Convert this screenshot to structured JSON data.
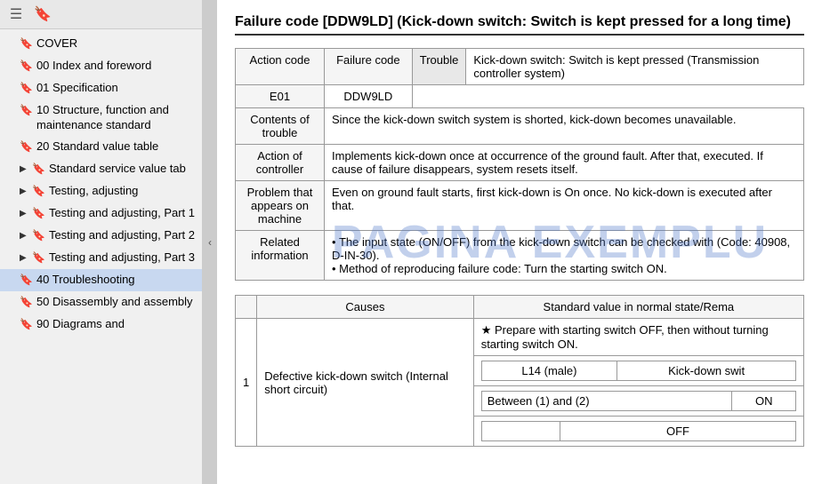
{
  "sidebar": {
    "toolbar": {
      "icon1": "☰",
      "icon2": "🔖"
    },
    "items": [
      {
        "id": "cover",
        "label": "COVER",
        "indent": 0,
        "expand": false,
        "hasExpand": false
      },
      {
        "id": "00-index",
        "label": "00 Index and foreword",
        "indent": 0,
        "expand": false,
        "hasExpand": false
      },
      {
        "id": "01-spec",
        "label": "01 Specification",
        "indent": 0,
        "expand": false,
        "hasExpand": false
      },
      {
        "id": "10-structure",
        "label": "10 Structure, function and maintenance standard",
        "indent": 0,
        "expand": false,
        "hasExpand": false
      },
      {
        "id": "20-standard",
        "label": "20 Standard value table",
        "indent": 0,
        "expand": false,
        "hasExpand": false
      },
      {
        "id": "std-service",
        "label": "Standard service value tab",
        "indent": 1,
        "expand": true,
        "hasExpand": true
      },
      {
        "id": "testing1",
        "label": "Testing, adjusting",
        "indent": 1,
        "expand": true,
        "hasExpand": true
      },
      {
        "id": "testing-adj-1",
        "label": "Testing and adjusting, Part 1",
        "indent": 1,
        "expand": false,
        "hasExpand": true
      },
      {
        "id": "testing-adj-2",
        "label": "Testing and adjusting, Part 2",
        "indent": 1,
        "expand": false,
        "hasExpand": true
      },
      {
        "id": "testing-adj-3",
        "label": "Testing and adjusting, Part 3",
        "indent": 1,
        "expand": false,
        "hasExpand": true
      },
      {
        "id": "40-trouble",
        "label": "40 Troubleshooting",
        "indent": 0,
        "expand": false,
        "hasExpand": false,
        "active": true
      },
      {
        "id": "50-disassembly",
        "label": "50 Disassembly and assembly",
        "indent": 0,
        "expand": false,
        "hasExpand": false
      },
      {
        "id": "90-diagrams",
        "label": "90 Diagrams and",
        "indent": 0,
        "expand": false,
        "hasExpand": false
      }
    ]
  },
  "main": {
    "title": "Failure code [DDW9LD] (Kick-down switch: Switch is kept pressed for a long time)",
    "info_table": {
      "headers": [
        "Action code",
        "Failure code",
        "Trouble"
      ],
      "action_code": "E01",
      "failure_code": "DDW9LD",
      "trouble_label": "Trouble",
      "trouble_desc": "Kick-down switch: Switch is kept pressed (Transmission controller system)",
      "rows": [
        {
          "header": "Contents of trouble",
          "content": "Since the kick-down switch system is shorted, kick-down becomes unavailable."
        },
        {
          "header": "Action of controller",
          "content": "Implements kick-down once at occurrence of the ground fault. After that, executed.\nIf cause of failure disappears, system resets itself."
        },
        {
          "header": "Problem that appears on machine",
          "content": "Even on ground fault starts, first kick-down is On once.\nNo kick-down is executed after that."
        },
        {
          "header": "Related information",
          "content1": "The input state (ON/OFF) from the kick-down switch can be checked with (Code: 40908, D-IN-30).",
          "content2": "Method of reproducing failure code: Turn the starting switch ON."
        }
      ]
    },
    "causes_table": {
      "headers": [
        "Causes",
        "Standard value in normal state/Rema"
      ],
      "rows": [
        {
          "num": "1",
          "cause": "Defective kick-down switch (Internal short circuit)",
          "sub_rows": [
            {
              "prep": "★ Prepare with starting switch OFF, then without turning starting switch ON.",
              "sub_headers": [
                "L14 (male)",
                "Kick-down swit"
              ],
              "sub_rows2": [
                {
                  "label": "Between (1) and (2)",
                  "val1": "ON"
                },
                {
                  "label": "",
                  "val2": "OFF"
                }
              ]
            }
          ]
        }
      ]
    }
  },
  "watermark": "PAGINA EXEMPLU"
}
